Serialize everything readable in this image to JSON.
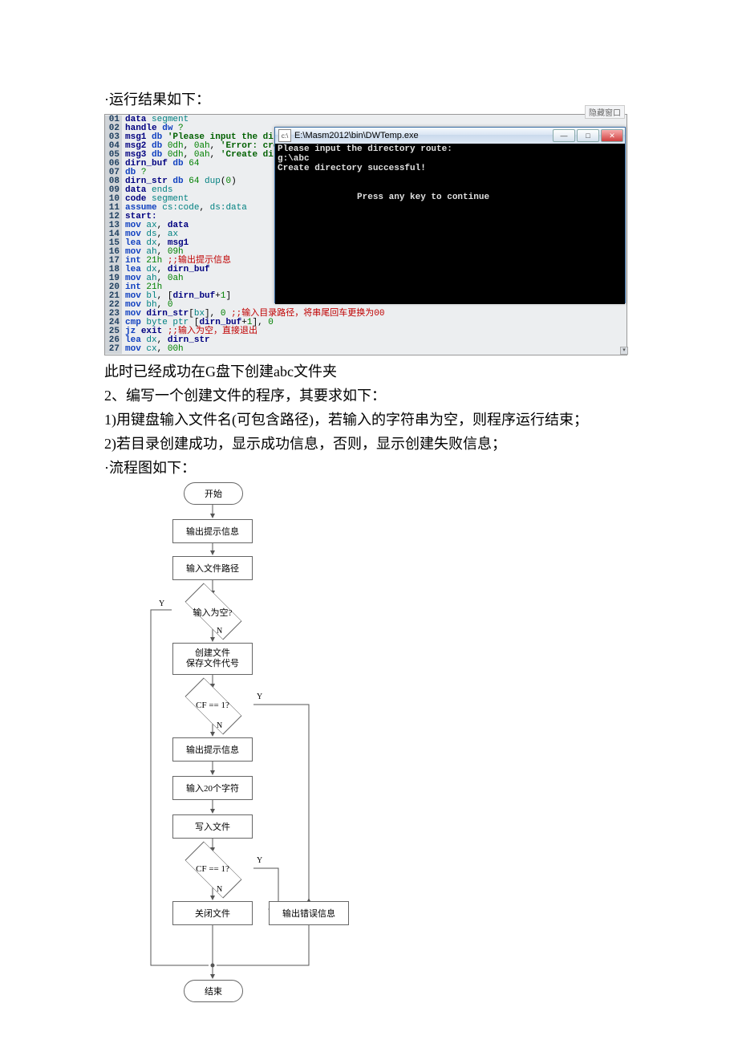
{
  "intro_bullet": "·运行结果如下：",
  "top_corner_label": "隐藏窗口",
  "code": {
    "lines": [
      [
        [
          "data",
          "kw-navy"
        ],
        [
          " ",
          "pl"
        ],
        [
          "segment",
          "kw-teal"
        ]
      ],
      [
        [
          "handle",
          "kw-navy"
        ],
        [
          " ",
          "pl"
        ],
        [
          "dw",
          "kw-blue"
        ],
        [
          " ",
          "pl"
        ],
        [
          "?",
          "kw-green"
        ]
      ],
      [
        [
          "msg1",
          "kw-navy"
        ],
        [
          " ",
          "pl"
        ],
        [
          "db",
          "kw-blue"
        ],
        [
          " ",
          "pl"
        ],
        [
          "'Please input the direct",
          "kw-darkgreen"
        ]
      ],
      [
        [
          "msg2",
          "kw-navy"
        ],
        [
          " ",
          "pl"
        ],
        [
          "db",
          "kw-blue"
        ],
        [
          " ",
          "pl"
        ],
        [
          "0dh",
          "kw-green"
        ],
        [
          ",",
          "pl"
        ],
        [
          " 0ah",
          "kw-green"
        ],
        [
          ",",
          "pl"
        ],
        [
          " ",
          "pl"
        ],
        [
          "'Error: create",
          "kw-darkgreen"
        ]
      ],
      [
        [
          "msg3",
          "kw-navy"
        ],
        [
          " ",
          "pl"
        ],
        [
          "db",
          "kw-blue"
        ],
        [
          " ",
          "pl"
        ],
        [
          "0dh",
          "kw-green"
        ],
        [
          ",",
          "pl"
        ],
        [
          " 0ah",
          "kw-green"
        ],
        [
          ",",
          "pl"
        ],
        [
          " ",
          "pl"
        ],
        [
          "'Create direct",
          "kw-darkgreen"
        ]
      ],
      [
        [
          "dirn_buf",
          "kw-navy"
        ],
        [
          " ",
          "pl"
        ],
        [
          "db",
          "kw-blue"
        ],
        [
          " ",
          "pl"
        ],
        [
          "64",
          "kw-green"
        ]
      ],
      [
        [
          "db",
          "kw-blue"
        ],
        [
          " ",
          "pl"
        ],
        [
          "?",
          "kw-green"
        ]
      ],
      [
        [
          "dirn_str",
          "kw-navy"
        ],
        [
          " ",
          "pl"
        ],
        [
          "db",
          "kw-blue"
        ],
        [
          " ",
          "pl"
        ],
        [
          "64",
          "kw-green"
        ],
        [
          " ",
          "pl"
        ],
        [
          "dup",
          "kw-teal"
        ],
        [
          "(",
          "pl"
        ],
        [
          "0",
          "kw-green"
        ],
        [
          ")",
          "pl"
        ]
      ],
      [
        [
          "data",
          "kw-navy"
        ],
        [
          " ",
          "pl"
        ],
        [
          "ends",
          "kw-teal"
        ]
      ],
      [
        [
          "code",
          "kw-navy"
        ],
        [
          " ",
          "pl"
        ],
        [
          "segment",
          "kw-teal"
        ]
      ],
      [
        [
          "assume",
          "kw-blue"
        ],
        [
          " ",
          "pl"
        ],
        [
          "cs:code",
          "kw-teal"
        ],
        [
          ",",
          "pl"
        ],
        [
          " ",
          "pl"
        ],
        [
          "ds:data",
          "kw-teal"
        ]
      ],
      [
        [
          "start:",
          "kw-navy"
        ]
      ],
      [
        [
          "mov",
          "kw-blue"
        ],
        [
          " ",
          "pl"
        ],
        [
          "ax",
          "kw-teal"
        ],
        [
          ",",
          "pl"
        ],
        [
          " ",
          "pl"
        ],
        [
          "data",
          "kw-navy"
        ]
      ],
      [
        [
          "mov",
          "kw-blue"
        ],
        [
          " ",
          "pl"
        ],
        [
          "ds",
          "kw-teal"
        ],
        [
          ",",
          "pl"
        ],
        [
          " ",
          "pl"
        ],
        [
          "ax",
          "kw-teal"
        ]
      ],
      [
        [
          "lea",
          "kw-blue"
        ],
        [
          " ",
          "pl"
        ],
        [
          "dx",
          "kw-teal"
        ],
        [
          ",",
          "pl"
        ],
        [
          " ",
          "pl"
        ],
        [
          "msg1",
          "kw-navy"
        ]
      ],
      [
        [
          "mov",
          "kw-blue"
        ],
        [
          " ",
          "pl"
        ],
        [
          "ah",
          "kw-teal"
        ],
        [
          ",",
          "pl"
        ],
        [
          " ",
          "pl"
        ],
        [
          "09h",
          "kw-green"
        ]
      ],
      [
        [
          "int",
          "kw-blue"
        ],
        [
          " ",
          "pl"
        ],
        [
          "21h",
          "kw-green"
        ],
        [
          " ",
          "pl"
        ],
        [
          ";;输出提示信息",
          "kw-comment"
        ]
      ],
      [
        [
          "lea",
          "kw-blue"
        ],
        [
          " ",
          "pl"
        ],
        [
          "dx",
          "kw-teal"
        ],
        [
          ",",
          "pl"
        ],
        [
          " ",
          "pl"
        ],
        [
          "dirn_buf",
          "kw-navy"
        ]
      ],
      [
        [
          "mov",
          "kw-blue"
        ],
        [
          " ",
          "pl"
        ],
        [
          "ah",
          "kw-teal"
        ],
        [
          ",",
          "pl"
        ],
        [
          " ",
          "pl"
        ],
        [
          "0ah",
          "kw-green"
        ]
      ],
      [
        [
          "int",
          "kw-blue"
        ],
        [
          " ",
          "pl"
        ],
        [
          "21h",
          "kw-green"
        ]
      ],
      [
        [
          "mov",
          "kw-blue"
        ],
        [
          " ",
          "pl"
        ],
        [
          "bl",
          "kw-teal"
        ],
        [
          ",",
          "pl"
        ],
        [
          " [",
          "pl"
        ],
        [
          "dirn_buf",
          "kw-navy"
        ],
        [
          "+",
          "pl"
        ],
        [
          "1",
          "kw-green"
        ],
        [
          "]",
          "pl"
        ]
      ],
      [
        [
          "mov",
          "kw-blue"
        ],
        [
          " ",
          "pl"
        ],
        [
          "bh",
          "kw-teal"
        ],
        [
          ",",
          "pl"
        ],
        [
          " ",
          "pl"
        ],
        [
          "0",
          "kw-green"
        ]
      ],
      [
        [
          "mov",
          "kw-blue"
        ],
        [
          " ",
          "pl"
        ],
        [
          "dirn_str",
          "kw-navy"
        ],
        [
          "[",
          "pl"
        ],
        [
          "bx",
          "kw-teal"
        ],
        [
          "],",
          "pl"
        ],
        [
          " ",
          "pl"
        ],
        [
          "0",
          "kw-green"
        ],
        [
          " ",
          "pl"
        ],
        [
          ";;输入目录路径，将串尾回车更换为00",
          "kw-comment"
        ]
      ],
      [
        [
          "cmp",
          "kw-blue"
        ],
        [
          " ",
          "pl"
        ],
        [
          "byte ptr",
          "kw-teal"
        ],
        [
          " [",
          "pl"
        ],
        [
          "dirn_buf",
          "kw-navy"
        ],
        [
          "+",
          "pl"
        ],
        [
          "1",
          "kw-green"
        ],
        [
          "],",
          "pl"
        ],
        [
          " ",
          "pl"
        ],
        [
          "0",
          "kw-green"
        ]
      ],
      [
        [
          "jz",
          "kw-blue"
        ],
        [
          " ",
          "pl"
        ],
        [
          "exit",
          "kw-navy"
        ],
        [
          " ",
          "pl"
        ],
        [
          ";;输入为空，直接退出",
          "kw-comment"
        ]
      ],
      [
        [
          "lea",
          "kw-blue"
        ],
        [
          " ",
          "pl"
        ],
        [
          "dx",
          "kw-teal"
        ],
        [
          ",",
          "pl"
        ],
        [
          " ",
          "pl"
        ],
        [
          "dirn_str",
          "kw-navy"
        ]
      ],
      [
        [
          "mov",
          "kw-blue"
        ],
        [
          " ",
          "pl"
        ],
        [
          "cx",
          "kw-teal"
        ],
        [
          ",",
          "pl"
        ],
        [
          " ",
          "pl"
        ],
        [
          "00h",
          "kw-green"
        ]
      ]
    ]
  },
  "terminal": {
    "title": "E:\\Masm2012\\bin\\DWTemp.exe",
    "content": "Please input the directory route:\ng:\\abc\nCreate directory successful!\n\n\n               Press any key to continue"
  },
  "para1": "此时已经成功在G盘下创建abc文件夹",
  "para2": "2、编写一个创建文件的程序，其要求如下：",
  "para3": "1)用键盘输入文件名(可包含路径)，若输入的字符串为空，则程序运行结束；",
  "para4": "2)若目录创建成功，显示成功信息，否则，显示创建失败信息；",
  "para5": "·流程图如下：",
  "fc": {
    "start": "开始",
    "out_prompt": "输出提示信息",
    "input_path": "输入文件路径",
    "empty": "输入为空?",
    "create": "创建文件\n保存文件代号",
    "cf1": "CF == 1?",
    "out_prompt2": "输出提示信息",
    "input20": "输入20个字符",
    "write": "写入文件",
    "cf2": "CF == 1?",
    "close": "关闭文件",
    "err": "输出错误信息",
    "end": "结束",
    "Y": "Y",
    "N": "N"
  }
}
